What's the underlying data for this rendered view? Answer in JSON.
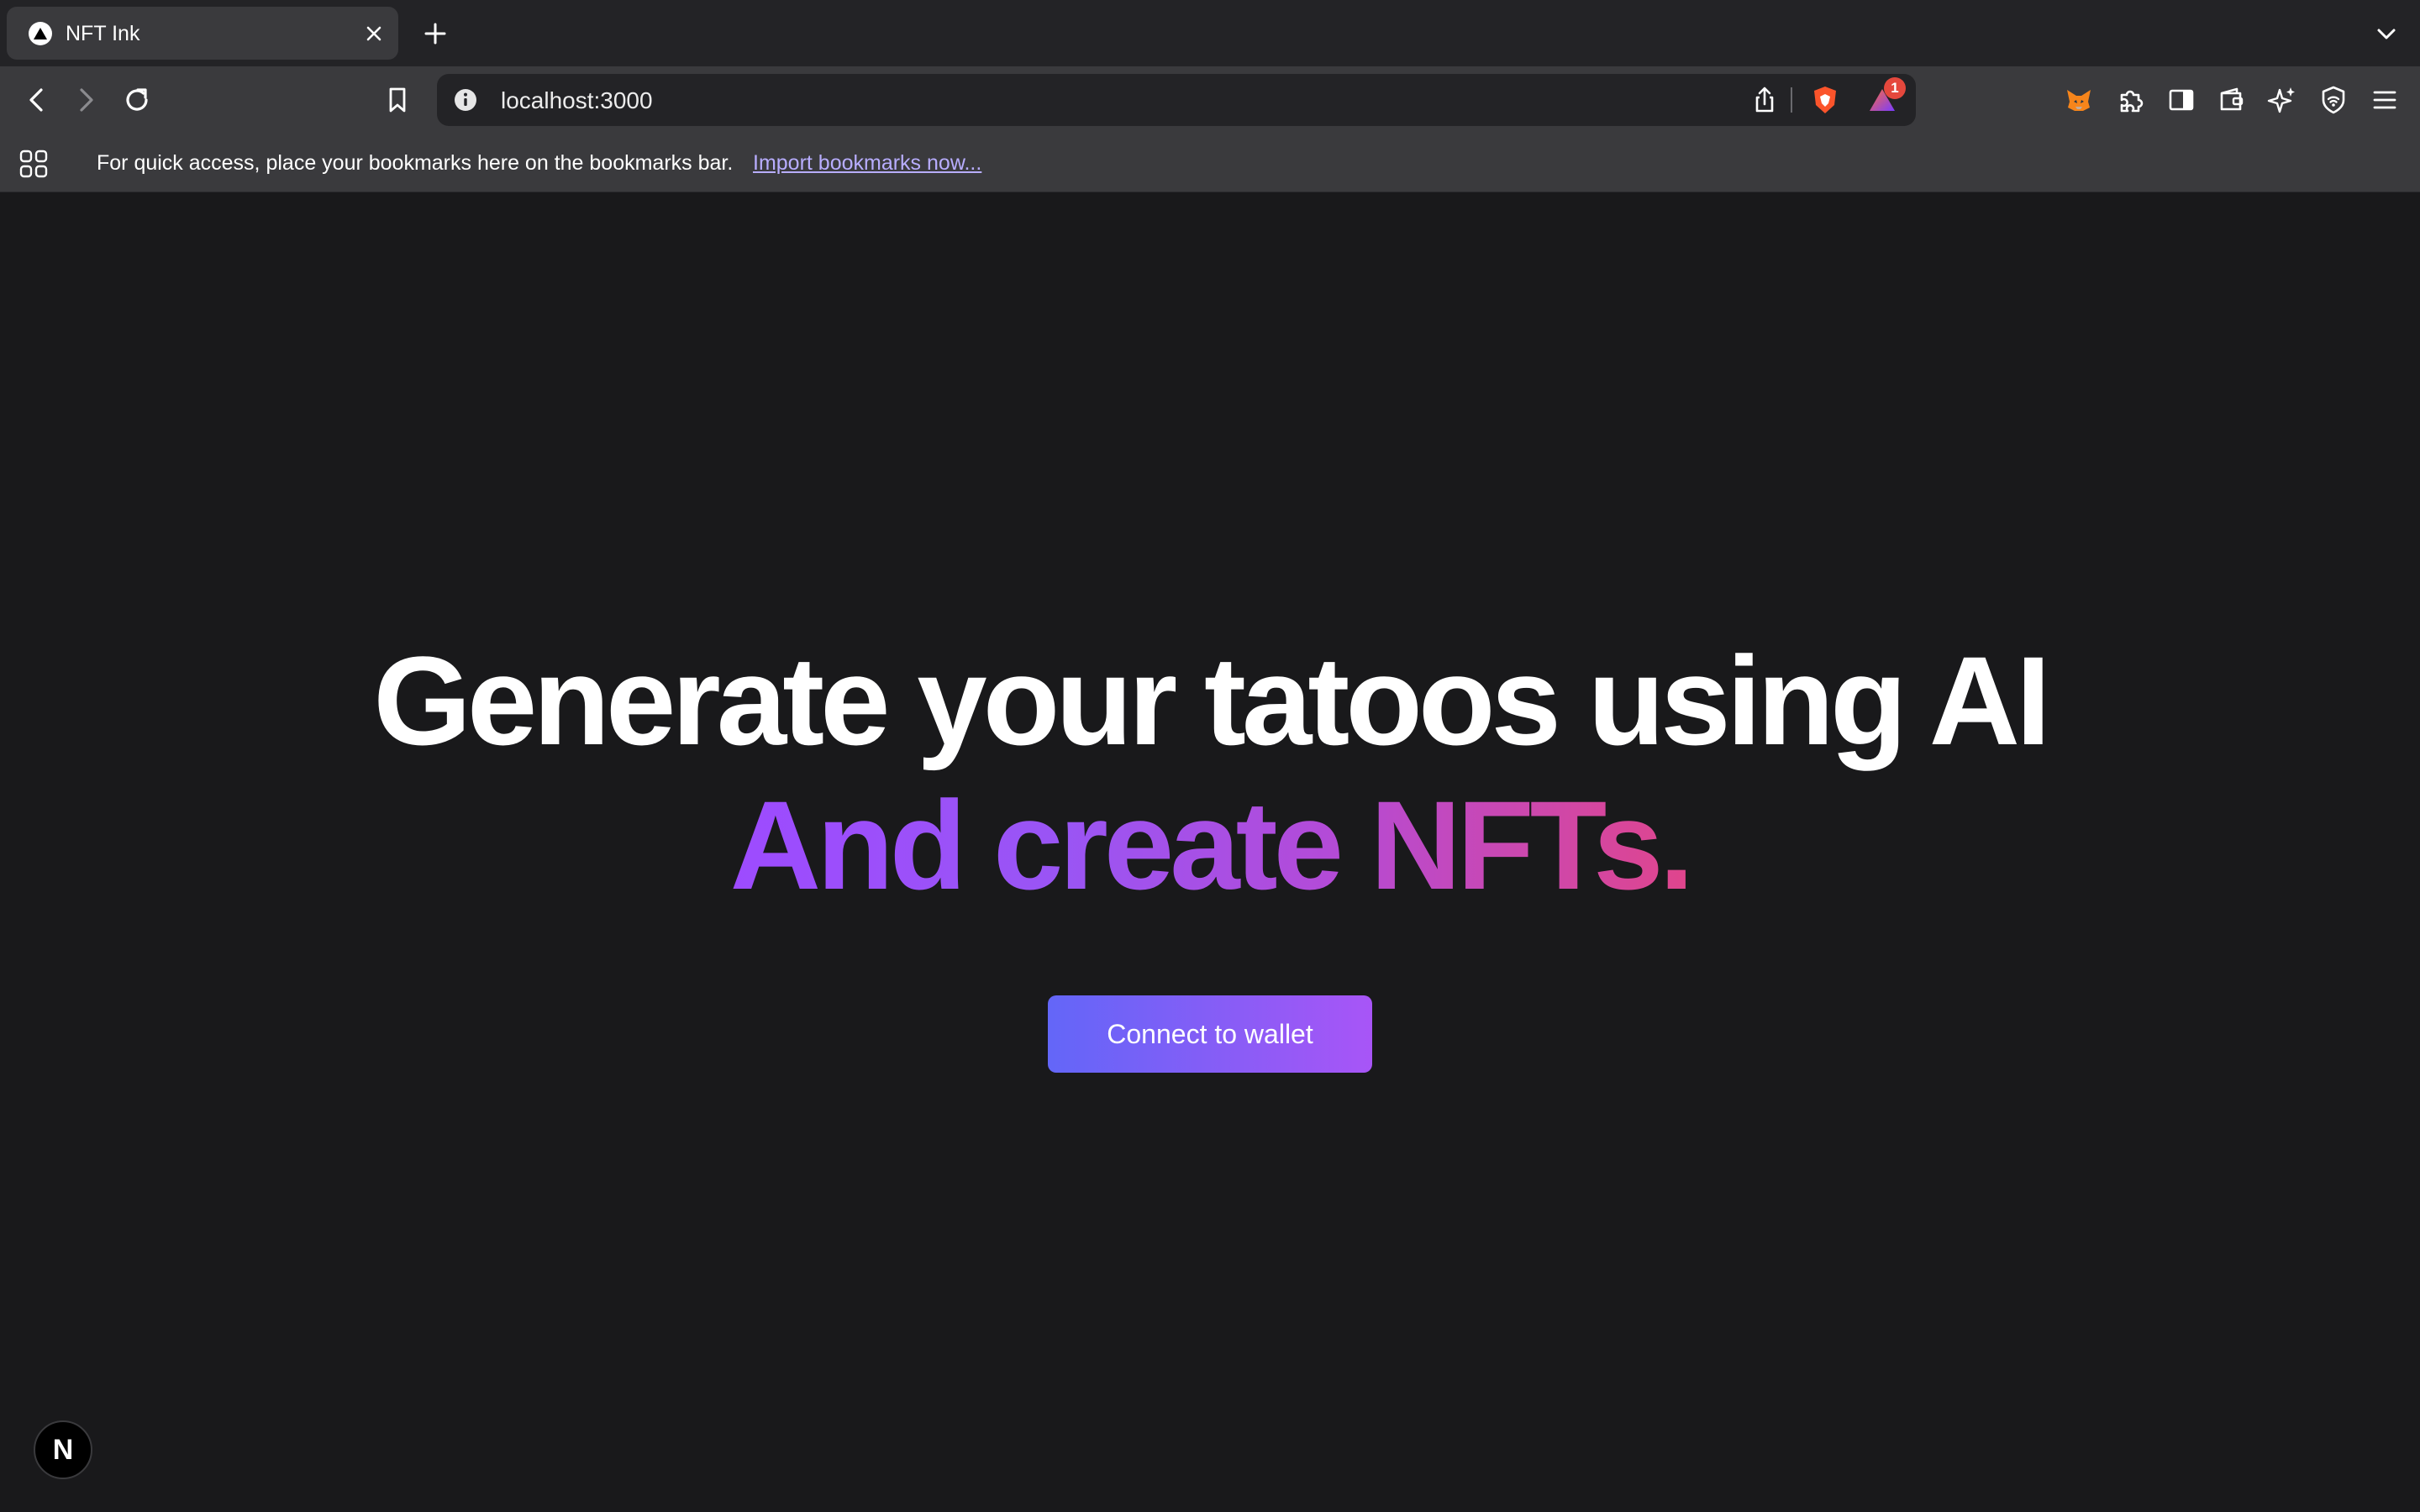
{
  "browser": {
    "tab": {
      "title": "NFT Ink",
      "favicon": "nextjs-triangle-icon"
    },
    "address": {
      "url": "localhost:3000"
    },
    "extensions": {
      "brave_rewards_badge": "1"
    }
  },
  "bookmarks_bar": {
    "message": "For quick access, place your bookmarks here on the bookmarks bar.",
    "import_link": "Import bookmarks now..."
  },
  "hero": {
    "headline_line1": "Generate your tatoos using AI",
    "headline_line2": "And create NFTs.",
    "cta_label": "Connect to wallet"
  },
  "dev_indicator": {
    "label": "N"
  },
  "colors": {
    "page_background": "#19191b",
    "gradient_start": "#9d4bff",
    "gradient_end": "#e0458c",
    "button_start": "#6366f8",
    "button_end": "#a855f7"
  }
}
